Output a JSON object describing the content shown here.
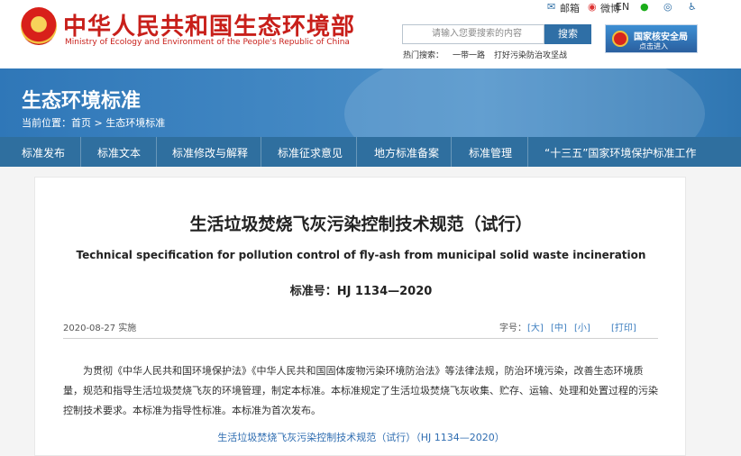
{
  "header": {
    "title_cn": "中华人民共和国生态环境部",
    "title_en": "Ministry of Ecology and Environment of the People's Republic of China",
    "links": [
      "邮箱",
      "微博",
      "EN"
    ],
    "icons": [
      "envelope-icon",
      "weibo-icon",
      "wechat-icon",
      "accessibility-icon"
    ],
    "search_placeholder": "请输入您要搜索的内容",
    "search_button": "搜索",
    "hot_label": "热门搜索：",
    "hot_terms": [
      "一带一路",
      "打好污染防治攻坚战"
    ],
    "nnsa_title": "国家核安全局",
    "nnsa_sub": "点击进入"
  },
  "banner": {
    "title": "生态环境标准",
    "breadcrumb_label": "当前位置：",
    "breadcrumb_home": "首页",
    "breadcrumb_sep": ">",
    "breadcrumb_current": "生态环境标准"
  },
  "nav": {
    "items": [
      "标准发布",
      "标准文本",
      "标准修改与解释",
      "标准征求意见",
      "地方标准备案",
      "标准管理",
      "“十三五”国家环境保护标准工作"
    ]
  },
  "article": {
    "title": "生活垃圾焚烧飞灰污染控制技术规范（试行）",
    "title_en": "Technical specification for pollution control of fly-ash from municipal solid waste incineration",
    "standard_no": "标准号：HJ 1134—2020",
    "date": "2020-08-27 实施",
    "font_label": "字号：",
    "font_sizes": [
      "[大]",
      "[中]",
      "[小]"
    ],
    "print": "[打印]",
    "body_line_1": "为贯彻《中华人民共和国环境保护法》《中华人民共和国固体废物污染环境防治法》等法律法规，防治环境污染，改善生态环境质量，规范和指导生活垃圾焚烧飞灰的环境管理，制定本标准。本标准规定了生活垃圾焚烧飞灰收集、贮存、运输、处理和处置过程的污染控制技术要求。本标准为指导性标准。本标准为首次发布。",
    "download_link": "生活垃圾焚烧飞灰污染控制技术规范（试行）（HJ 1134—2020）"
  }
}
